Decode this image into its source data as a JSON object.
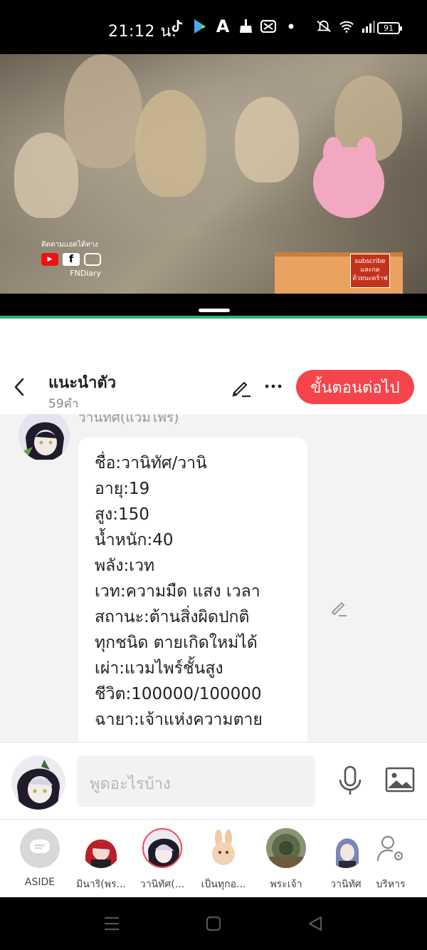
{
  "status_bar": {
    "time": "21:12 น.",
    "battery": "91",
    "icons": [
      "tiktok-icon",
      "play-store-icon",
      "font-a-icon",
      "broom-icon",
      "capcut-icon",
      "dot-icon",
      "mute-icon",
      "wifi-icon",
      "signal-icon"
    ]
  },
  "video": {
    "follow_text": "ติดตามเเอดได้ทาง",
    "channel": "FNDiary",
    "subscribe_line1": "subscribe",
    "subscribe_line2": "และกด",
    "subscribe_line3": "ด้วยนะคร้าฟ"
  },
  "header": {
    "title": "แนะนำตัว",
    "subtitle": "59คำ",
    "next_label": "ขั้นตอนต่อไป"
  },
  "message": {
    "author_name": "วานิทัศ(แวมไพร)",
    "lines": [
      "ชื่อ:วานิทัศ/วานิ",
      "อายุ:19",
      "สูง:150",
      "น้ำหนัก:40",
      "พลัง:เวท",
      "เวท:ความมืด แสง เวลา",
      "สถานะ:ต้านสิ่งผิดปกติ",
      "ทุกชนิด ตายเกิดใหม่ได้",
      "เผ่า:แวมไพร์ชั้นสูง",
      "ชีวิต:100000/100000",
      "ฉายา:เจ้าแห่งความตาย"
    ]
  },
  "input": {
    "placeholder": "พูดอะไรบ้าง"
  },
  "characters": [
    {
      "label": "ASIDE",
      "color": "#d8d8d8"
    },
    {
      "label": "มินาริ(พร...",
      "color": "#b9202a"
    },
    {
      "label": "วานิทัศ(...",
      "color": "#6c6a8e"
    },
    {
      "label": "เป็นทุกอ...",
      "color": "#f0c9a5"
    },
    {
      "label": "พระเจ้า",
      "color": "#5c6b48"
    },
    {
      "label": "วานิทัศ",
      "color": "#7a86b6"
    },
    {
      "label": "บริหาร",
      "color": "#ffffff"
    }
  ],
  "colors": {
    "accent": "#f5444b",
    "green_line": "#2db36e"
  }
}
